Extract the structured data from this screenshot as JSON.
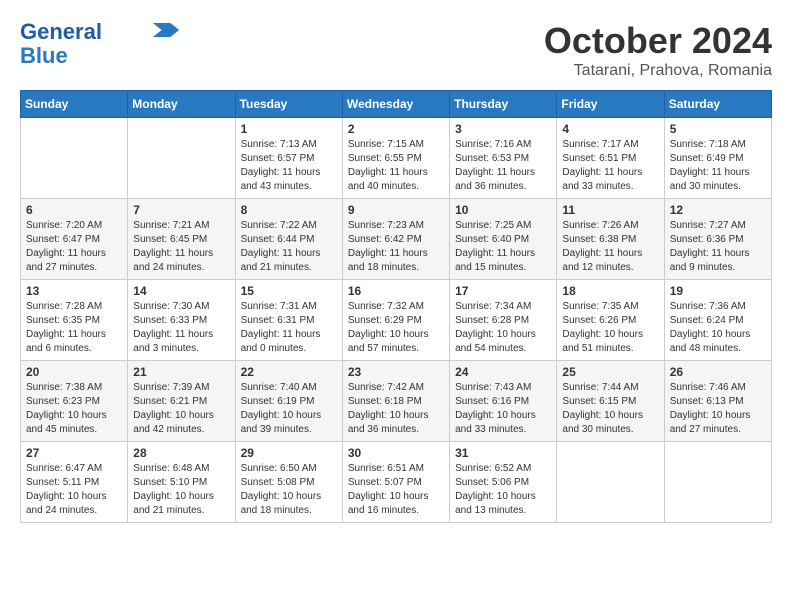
{
  "header": {
    "logo_line1": "General",
    "logo_line2": "Blue",
    "month": "October 2024",
    "location": "Tatarani, Prahova, Romania"
  },
  "days_of_week": [
    "Sunday",
    "Monday",
    "Tuesday",
    "Wednesday",
    "Thursday",
    "Friday",
    "Saturday"
  ],
  "weeks": [
    [
      {
        "day": "",
        "info": ""
      },
      {
        "day": "",
        "info": ""
      },
      {
        "day": "1",
        "info": "Sunrise: 7:13 AM\nSunset: 6:57 PM\nDaylight: 11 hours and 43 minutes."
      },
      {
        "day": "2",
        "info": "Sunrise: 7:15 AM\nSunset: 6:55 PM\nDaylight: 11 hours and 40 minutes."
      },
      {
        "day": "3",
        "info": "Sunrise: 7:16 AM\nSunset: 6:53 PM\nDaylight: 11 hours and 36 minutes."
      },
      {
        "day": "4",
        "info": "Sunrise: 7:17 AM\nSunset: 6:51 PM\nDaylight: 11 hours and 33 minutes."
      },
      {
        "day": "5",
        "info": "Sunrise: 7:18 AM\nSunset: 6:49 PM\nDaylight: 11 hours and 30 minutes."
      }
    ],
    [
      {
        "day": "6",
        "info": "Sunrise: 7:20 AM\nSunset: 6:47 PM\nDaylight: 11 hours and 27 minutes."
      },
      {
        "day": "7",
        "info": "Sunrise: 7:21 AM\nSunset: 6:45 PM\nDaylight: 11 hours and 24 minutes."
      },
      {
        "day": "8",
        "info": "Sunrise: 7:22 AM\nSunset: 6:44 PM\nDaylight: 11 hours and 21 minutes."
      },
      {
        "day": "9",
        "info": "Sunrise: 7:23 AM\nSunset: 6:42 PM\nDaylight: 11 hours and 18 minutes."
      },
      {
        "day": "10",
        "info": "Sunrise: 7:25 AM\nSunset: 6:40 PM\nDaylight: 11 hours and 15 minutes."
      },
      {
        "day": "11",
        "info": "Sunrise: 7:26 AM\nSunset: 6:38 PM\nDaylight: 11 hours and 12 minutes."
      },
      {
        "day": "12",
        "info": "Sunrise: 7:27 AM\nSunset: 6:36 PM\nDaylight: 11 hours and 9 minutes."
      }
    ],
    [
      {
        "day": "13",
        "info": "Sunrise: 7:28 AM\nSunset: 6:35 PM\nDaylight: 11 hours and 6 minutes."
      },
      {
        "day": "14",
        "info": "Sunrise: 7:30 AM\nSunset: 6:33 PM\nDaylight: 11 hours and 3 minutes."
      },
      {
        "day": "15",
        "info": "Sunrise: 7:31 AM\nSunset: 6:31 PM\nDaylight: 11 hours and 0 minutes."
      },
      {
        "day": "16",
        "info": "Sunrise: 7:32 AM\nSunset: 6:29 PM\nDaylight: 10 hours and 57 minutes."
      },
      {
        "day": "17",
        "info": "Sunrise: 7:34 AM\nSunset: 6:28 PM\nDaylight: 10 hours and 54 minutes."
      },
      {
        "day": "18",
        "info": "Sunrise: 7:35 AM\nSunset: 6:26 PM\nDaylight: 10 hours and 51 minutes."
      },
      {
        "day": "19",
        "info": "Sunrise: 7:36 AM\nSunset: 6:24 PM\nDaylight: 10 hours and 48 minutes."
      }
    ],
    [
      {
        "day": "20",
        "info": "Sunrise: 7:38 AM\nSunset: 6:23 PM\nDaylight: 10 hours and 45 minutes."
      },
      {
        "day": "21",
        "info": "Sunrise: 7:39 AM\nSunset: 6:21 PM\nDaylight: 10 hours and 42 minutes."
      },
      {
        "day": "22",
        "info": "Sunrise: 7:40 AM\nSunset: 6:19 PM\nDaylight: 10 hours and 39 minutes."
      },
      {
        "day": "23",
        "info": "Sunrise: 7:42 AM\nSunset: 6:18 PM\nDaylight: 10 hours and 36 minutes."
      },
      {
        "day": "24",
        "info": "Sunrise: 7:43 AM\nSunset: 6:16 PM\nDaylight: 10 hours and 33 minutes."
      },
      {
        "day": "25",
        "info": "Sunrise: 7:44 AM\nSunset: 6:15 PM\nDaylight: 10 hours and 30 minutes."
      },
      {
        "day": "26",
        "info": "Sunrise: 7:46 AM\nSunset: 6:13 PM\nDaylight: 10 hours and 27 minutes."
      }
    ],
    [
      {
        "day": "27",
        "info": "Sunrise: 6:47 AM\nSunset: 5:11 PM\nDaylight: 10 hours and 24 minutes."
      },
      {
        "day": "28",
        "info": "Sunrise: 6:48 AM\nSunset: 5:10 PM\nDaylight: 10 hours and 21 minutes."
      },
      {
        "day": "29",
        "info": "Sunrise: 6:50 AM\nSunset: 5:08 PM\nDaylight: 10 hours and 18 minutes."
      },
      {
        "day": "30",
        "info": "Sunrise: 6:51 AM\nSunset: 5:07 PM\nDaylight: 10 hours and 16 minutes."
      },
      {
        "day": "31",
        "info": "Sunrise: 6:52 AM\nSunset: 5:06 PM\nDaylight: 10 hours and 13 minutes."
      },
      {
        "day": "",
        "info": ""
      },
      {
        "day": "",
        "info": ""
      }
    ]
  ]
}
